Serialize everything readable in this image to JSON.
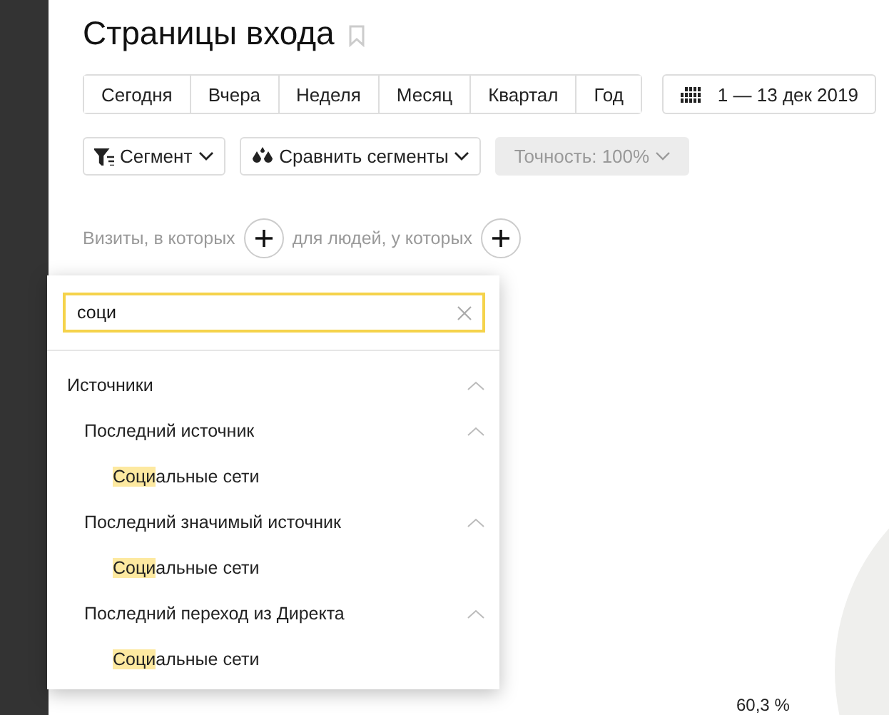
{
  "title": "Страницы входа",
  "periods": [
    {
      "label": "Сегодня",
      "selected": false
    },
    {
      "label": "Вчера",
      "selected": false
    },
    {
      "label": "Неделя",
      "selected": false
    },
    {
      "label": "Месяц",
      "selected": false
    },
    {
      "label": "Квартал",
      "selected": false
    },
    {
      "label": "Год",
      "selected": false
    }
  ],
  "date_range": "1 — 13 дек 2019",
  "segment_button": "Сегмент",
  "compare_button": "Сравнить сегменты",
  "accuracy_button": {
    "label": "Точность: 100%",
    "disabled": true
  },
  "condition": {
    "visits_label": "Визиты, в которых",
    "people_label": "для людей, у которых"
  },
  "popup": {
    "search": {
      "value": "соци"
    },
    "tree": [
      {
        "label": "Источники",
        "expanded": true,
        "children": [
          {
            "label": "Последний источник",
            "expanded": true,
            "children": [
              {
                "match": "Соци",
                "rest": "альные сети"
              }
            ]
          },
          {
            "label": "Последний значимый источник",
            "expanded": true,
            "children": [
              {
                "match": "Соци",
                "rest": "альные сети"
              }
            ]
          },
          {
            "label": "Последний переход из Директа",
            "expanded": true,
            "children": [
              {
                "match": "Соци",
                "rest": "альные сети"
              }
            ]
          }
        ]
      }
    ]
  },
  "chart_label": "60,3 %"
}
